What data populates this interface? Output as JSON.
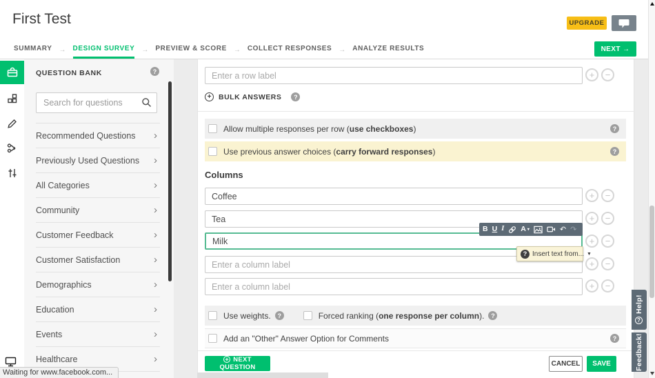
{
  "header": {
    "title": "First Test",
    "upgrade": "UPGRADE"
  },
  "nav": {
    "tabs": [
      "SUMMARY",
      "DESIGN SURVEY",
      "PREVIEW & SCORE",
      "COLLECT RESPONSES",
      "ANALYZE RESULTS"
    ],
    "active_tab": "DESIGN SURVEY",
    "separator": "→",
    "next": "NEXT",
    "next_arrow": "→"
  },
  "sidebar": {
    "title": "QUESTION BANK",
    "search_placeholder": "Search for questions",
    "items": [
      "Recommended Questions",
      "Previously Used Questions",
      "All Categories",
      "Community",
      "Customer Feedback",
      "Customer Satisfaction",
      "Demographics",
      "Education",
      "Events",
      "Healthcare"
    ]
  },
  "question_editor": {
    "row_placeholder": "Enter a row label",
    "bulk_answers": "BULK ANSWERS",
    "allow_multiple": {
      "pre": "Allow multiple responses per row (",
      "bold": "use checkboxes",
      "post": ")"
    },
    "previous_answers": {
      "pre": "Use previous answer choices (",
      "bold": "carry forward responses",
      "post": ")"
    },
    "columns_heading": "Columns",
    "columns": [
      "Coffee",
      "Tea",
      "Milk"
    ],
    "column_placeholder": "Enter a column label",
    "insert_text_from": "Insert text from...",
    "use_weights": "Use weights.",
    "forced_ranking": {
      "pre": "Forced ranking (",
      "bold": "one response per column",
      "post": ")."
    },
    "other_option": "Add an \"Other\" Answer Option for Comments",
    "next_question": "NEXT QUESTION",
    "cancel": "CANCEL",
    "save": "SAVE"
  },
  "toolbar": {
    "bold": "B",
    "underline": "U",
    "italic": "I",
    "font": "A",
    "caret": "▾",
    "undo": "↶",
    "redo": "↷"
  },
  "widgets": {
    "help": "Help!",
    "feedback": "Feedback!",
    "status": "Waiting for www.facebook.com...",
    "plus": "+",
    "minus": "−",
    "chevron": "›",
    "question": "?",
    "dropdown_caret": "▼"
  },
  "colors": {
    "green": "#00BF6F",
    "upgrade_yellow": "#F7BE16",
    "slate": "#5D6A75",
    "highlight_row": "#FAF3D1",
    "row_gray": "#F0F0F0",
    "focus_border": "#56BB92"
  }
}
